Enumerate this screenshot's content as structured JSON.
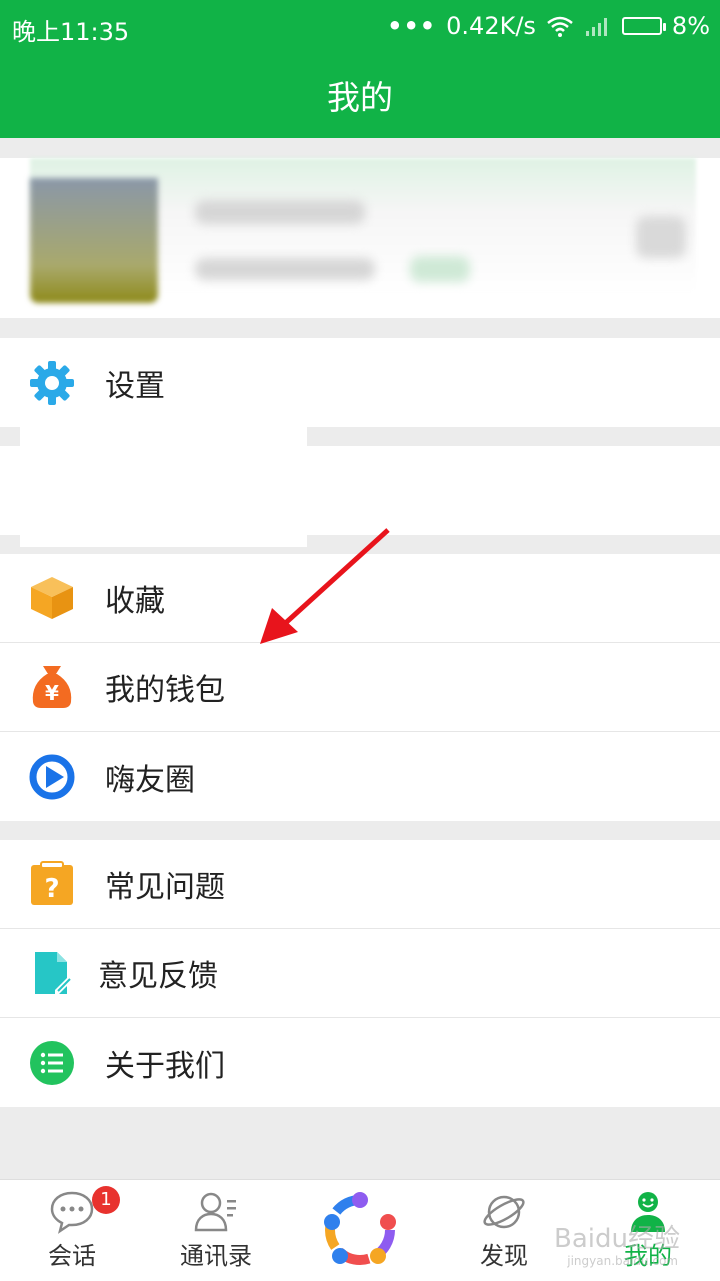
{
  "status": {
    "time": "晚上11:35",
    "dots": "•••",
    "speed": "0.42K/s",
    "battery": "8%"
  },
  "header": {
    "title": "我的"
  },
  "settings": {
    "label": "设置"
  },
  "menu1": [
    {
      "label": "收藏",
      "icon": "box-icon",
      "color": "#f5a623"
    },
    {
      "label": "我的钱包",
      "icon": "money-bag-icon",
      "color": "#f36b21"
    },
    {
      "label": "嗨友圈",
      "icon": "circle-play-icon",
      "color": "#1a73e8"
    }
  ],
  "menu2": [
    {
      "label": "常见问题",
      "icon": "question-clipboard-icon",
      "color": "#f5a623"
    },
    {
      "label": "意见反馈",
      "icon": "feedback-file-icon",
      "color": "#26c6c6"
    },
    {
      "label": "关于我们",
      "icon": "list-circle-icon",
      "color": "#22c35e"
    }
  ],
  "tabs": [
    {
      "label": "会话",
      "badge": "1"
    },
    {
      "label": "通讯录"
    },
    {
      "label": ""
    },
    {
      "label": "发现"
    },
    {
      "label": "我的"
    }
  ],
  "watermark": {
    "text": "Baidu经验",
    "sub": "jingyan.baidu.com"
  },
  "colors": {
    "brand": "#11b347",
    "active_tab": "#11b347"
  }
}
